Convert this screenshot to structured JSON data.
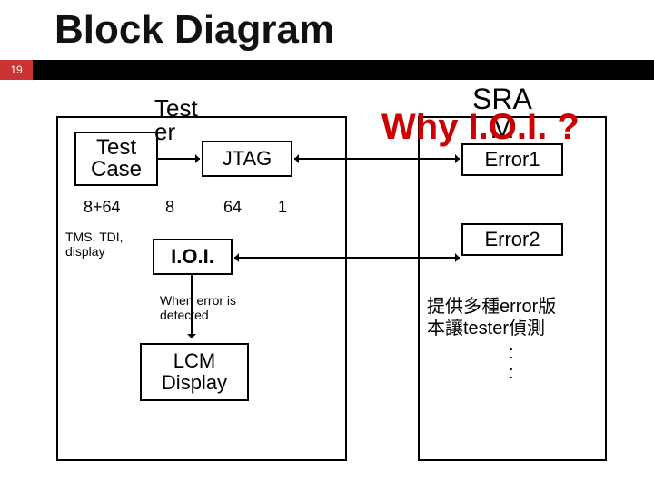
{
  "title": "Block Diagram",
  "slide_number": "19",
  "left": {
    "tester_label": "Test\ner",
    "test_case_box": "Test\nCase",
    "jtag_box": "JTAG",
    "n_8_64": "8+64",
    "n_8": "8",
    "n_64": "64",
    "n_1": "1",
    "tms_tdi": "TMS, TDI,\ndisplay",
    "ioi_box": "I.O.I.",
    "when_error": "When error is\ndetected",
    "lcm_box": "LCM\nDisplay"
  },
  "right": {
    "sram_label": "SRA\nM",
    "error1_box": "Error1",
    "error2_box": "Error2",
    "footer_text": "提供多種error版\n本讓tester偵測",
    "dots": ":\n:"
  },
  "overlay": {
    "why": "Why I.O.I. ?"
  }
}
